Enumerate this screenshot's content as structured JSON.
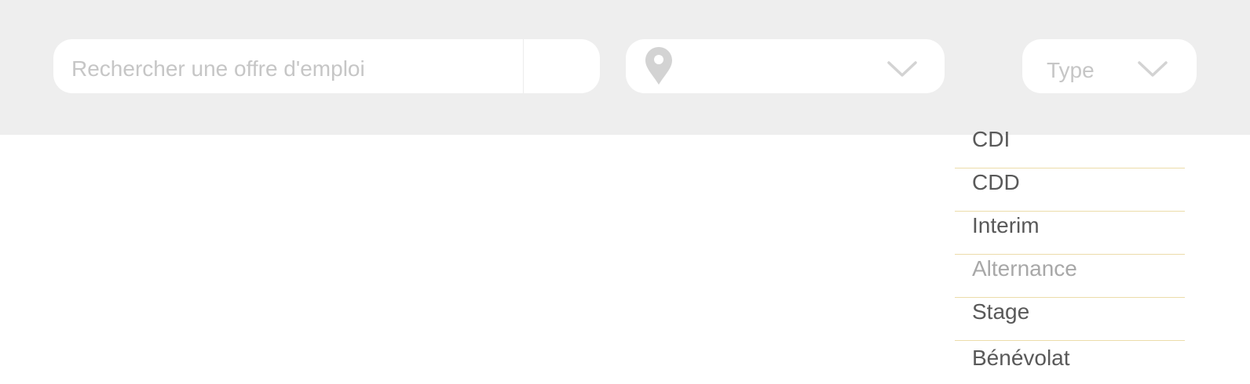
{
  "search": {
    "placeholder": "Rechercher une offre d'emploi",
    "value": "",
    "icon": "search-icon"
  },
  "location": {
    "icon": "map-pin-icon",
    "value": "",
    "chevron_icon": "chevron-down-icon"
  },
  "type_filter": {
    "label": "Type",
    "chevron_icon": "chevron-down-icon",
    "options": [
      {
        "label": "CDI",
        "state": "normal"
      },
      {
        "label": "CDD",
        "state": "normal"
      },
      {
        "label": "Interim",
        "state": "normal"
      },
      {
        "label": "Alternance",
        "state": "dimmed"
      },
      {
        "label": "Stage",
        "state": "normal"
      },
      {
        "label": "Bénévolat",
        "state": "normal"
      }
    ]
  },
  "colors": {
    "top_bar_background": "#eeeeee",
    "field_background": "#ffffff",
    "icon_grey": "#d3d3d3",
    "placeholder_text": "#c6c6c6",
    "option_text": "#595959",
    "option_text_dimmed": "#a8a8a8",
    "option_divider": "#ecdcaa"
  }
}
